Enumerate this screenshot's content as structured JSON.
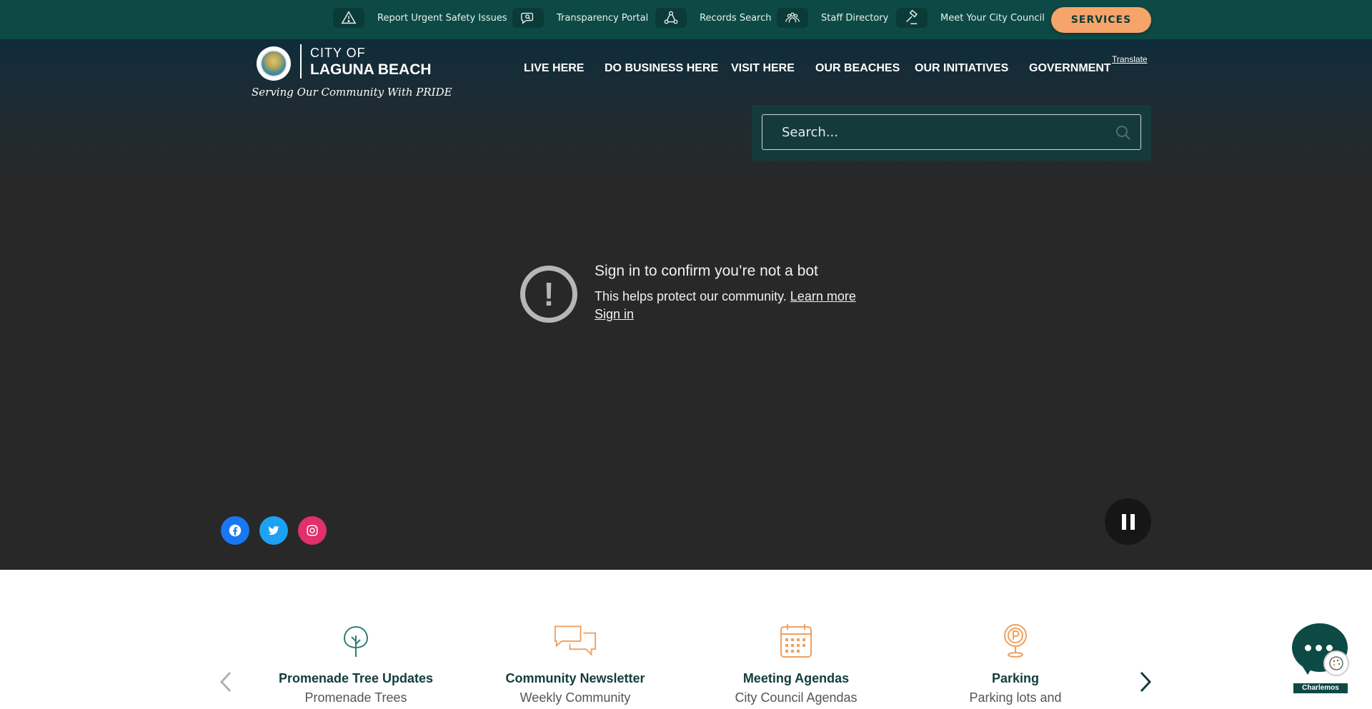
{
  "utility_bar": {
    "items": [
      {
        "label": "Report Urgent Safety Issues",
        "icon": "warning-icon"
      },
      {
        "label": "Transparency Portal",
        "icon": "chat-search-icon"
      },
      {
        "label": "Records Search",
        "icon": "network-icon"
      },
      {
        "label": "Staff Directory",
        "icon": "people-icon"
      },
      {
        "label": "Meet Your City Council",
        "icon": "gavel-icon"
      }
    ],
    "services_label": "SERVICES"
  },
  "logo": {
    "city_of": "CITY OF",
    "name": "LAGUNA BEACH",
    "tagline": "Serving Our Community With PRIDE"
  },
  "nav": {
    "items": [
      {
        "label": "LIVE HERE"
      },
      {
        "label": "DO BUSINESS HERE"
      },
      {
        "label": "VISIT HERE"
      },
      {
        "label": "OUR BEACHES"
      },
      {
        "label": "OUR INITIATIVES"
      },
      {
        "label": "GOVERNMENT"
      }
    ],
    "translate_label": "Translate"
  },
  "search": {
    "placeholder": "Search...",
    "value": ""
  },
  "video_notice": {
    "icon": "exclamation-icon",
    "title": "Sign in to confirm you’re not a bot",
    "text": "This helps protect our community.",
    "learn_more": "Learn more",
    "sign_in": "Sign in"
  },
  "social": [
    {
      "name": "facebook",
      "color": "#1877f2"
    },
    {
      "name": "twitter",
      "color": "#1da1f2"
    },
    {
      "name": "instagram",
      "color": "#e1306c"
    }
  ],
  "quick_links": [
    {
      "title": "Promenade Tree Updates",
      "subtitle": "Promenade Trees",
      "icon": "tree-icon",
      "color": "#2f7d74"
    },
    {
      "title": "Community Newsletter",
      "subtitle": "Weekly Community",
      "icon": "chat-bubbles-icon",
      "color": "#f0a060"
    },
    {
      "title": "Meeting Agendas",
      "subtitle": "City Council Agendas",
      "icon": "calendar-icon",
      "color": "#f0a060"
    },
    {
      "title": "Parking",
      "subtitle": "Parking lots and",
      "icon": "parking-pin-icon",
      "color": "#f0a060"
    }
  ],
  "chat_widget": {
    "label": "Charlemos"
  },
  "colors": {
    "brand_dark": "#0d4a46",
    "accent_orange": "#f6a469",
    "hero_bg": "#282828"
  }
}
